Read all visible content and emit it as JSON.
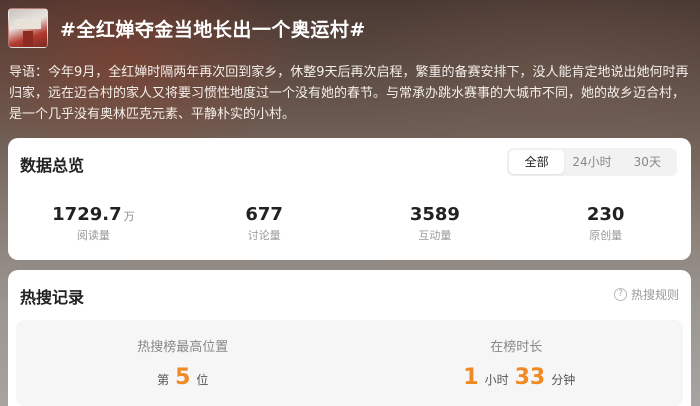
{
  "header": {
    "title": "#全红婵夺金当地长出一个奥运村#"
  },
  "intro": "导语：今年9月，全红婵时隔两年再次回到家乡，休整9天后再次启程，繁重的备赛安排下，没人能肯定地说出她何时再归家，远在迈合村的家人又将要习惯性地度过一个没有她的春节。与常承办跳水赛事的大城市不同，她的故乡迈合村，是一个几乎没有奥林匹克元素、平静朴实的小村。",
  "overview": {
    "title": "数据总览",
    "tabs": [
      "全部",
      "24小时",
      "30天"
    ],
    "stats": [
      {
        "value": "1729.7",
        "unit": "万",
        "label": "阅读量"
      },
      {
        "value": "677",
        "unit": "",
        "label": "讨论量"
      },
      {
        "value": "3589",
        "unit": "",
        "label": "互动量"
      },
      {
        "value": "230",
        "unit": "",
        "label": "原创量"
      }
    ]
  },
  "hot": {
    "title": "热搜记录",
    "rule_icon": "?",
    "rule_label": "热搜规则",
    "peak_label": "热搜榜最高位置",
    "peak_prefix": "第",
    "peak_value": "5",
    "peak_suffix": "位",
    "duration_label": "在榜时长",
    "hours_value": "1",
    "hours_unit": "小时",
    "minutes_value": "33",
    "minutes_unit": "分钟"
  },
  "colors": {
    "accent": "#f08a24"
  }
}
